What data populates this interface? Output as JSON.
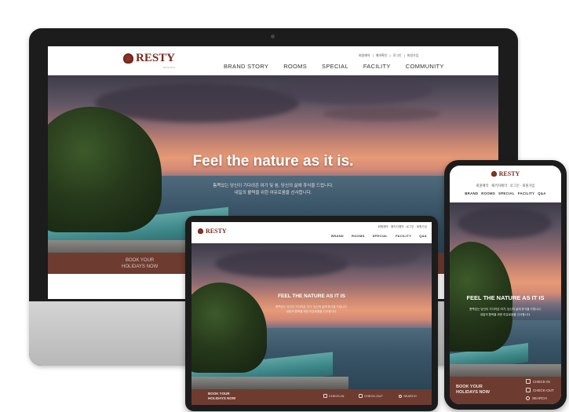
{
  "desktop": {
    "brand": "RESTY",
    "brand_sub": "RESORT",
    "util_links": [
      "회원예약",
      "예약확인",
      "로그인",
      "회원가입"
    ],
    "nav": [
      "BRAND STORY",
      "ROOMS",
      "SPECIAL",
      "FACILITY",
      "COMMUNITY"
    ],
    "headline": "Feel the nature as it is.",
    "subtext_line1": "틈쪽있는 당신이 기다려온 여가 및 쉼, 당신의 삶에 휴식을 드립니다.",
    "subtext_line2": "내일의 활력을 위한 여유로움을 선사합니다.",
    "book_line1": "BOOK YOUR",
    "book_line2": "HOLIDAYS NOW"
  },
  "tablet": {
    "brand": "RESTY",
    "util_links": "회원예약 · 패키지예약 · 로그인 · 회원가입",
    "nav": [
      "BRAND",
      "ROOMS",
      "SPECIAL",
      "FACILITY",
      "Q&A"
    ],
    "headline": "FEEL THE NATURE AS IT IS",
    "subtext_line1": "틈쪽있는 당신이 기다려온 여가, 당신의 삶에 휴식을 드립니다.",
    "subtext_line2": "내일의 활력을 위한 여유로움을 선사합니다.",
    "book_line1": "BOOK YOUR",
    "book_line2": "HOLIDAYS NOW",
    "check_in": "CHECK-IN",
    "check_out": "CHECK-OUT",
    "search": "SEARCH"
  },
  "phone": {
    "brand": "RESTY",
    "util_links": "회원예약 · 패키지예약 · 로그인 · 회원가입",
    "nav": [
      "BRAND",
      "ROOMS",
      "SPECIAL",
      "FACILITY",
      "Q&A"
    ],
    "headline": "FEEL THE NATURE AS IT IS",
    "subtext_line1": "틈쪽있는 당신이 기다려온 여가, 당신의 삶에 휴식을 드립니다.",
    "subtext_line2": "내일의 활력을 위한 여유로움을 선사합니다.",
    "book_line1": "BOOK YOUR",
    "book_line2": "HOLIDAYS NOW",
    "check_in": "CHECK-IN",
    "check_out": "CHECK-OUT",
    "search": "SEARCH"
  },
  "colors": {
    "brand": "#7a2a1d",
    "booking_bar": "#6e3b30",
    "device_frame": "#1c1c1c",
    "monitor_chin": "#c8c8c8"
  }
}
